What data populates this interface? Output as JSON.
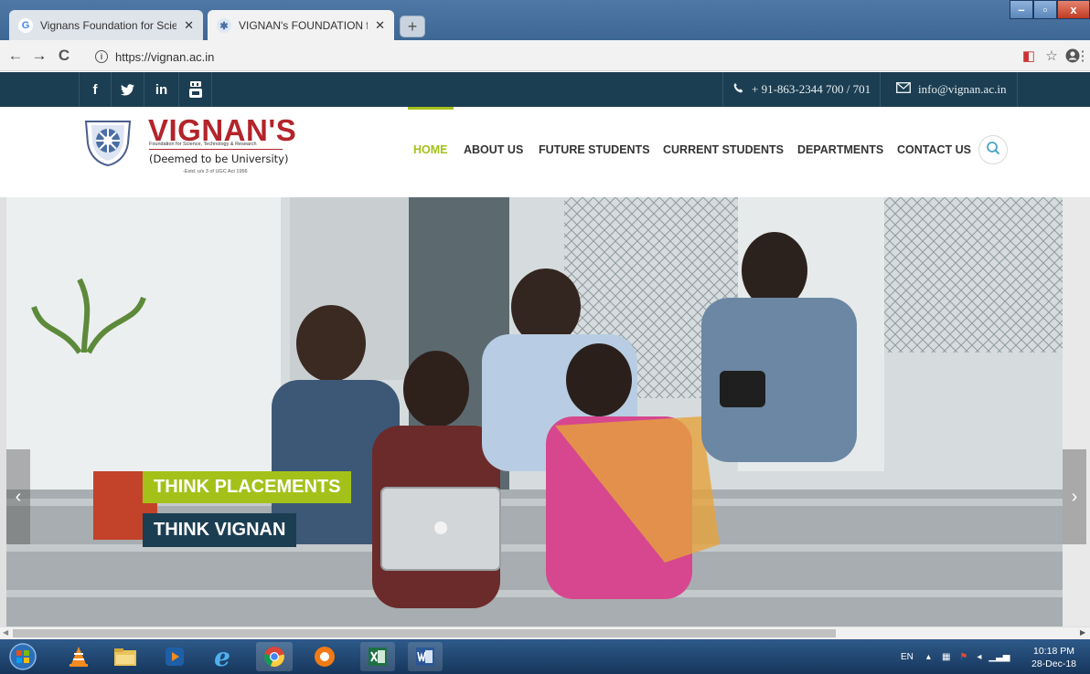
{
  "browser": {
    "tabs": [
      {
        "title": "Vignans Foundation for Science T",
        "favicon": "G",
        "active": false
      },
      {
        "title": "VIGNAN's FOUNDATION for SCIE",
        "favicon": "crest",
        "active": true
      }
    ],
    "url": "https://vignan.ac.in",
    "close_glyph": "✕",
    "new_tab_glyph": "+",
    "window_buttons": {
      "minimize": "–",
      "maximize": "▫",
      "close": "x"
    },
    "nav": {
      "back": "←",
      "forward": "→",
      "reload": "C"
    }
  },
  "site": {
    "social": [
      "f",
      "𝕪",
      "in",
      "▶"
    ],
    "contact": {
      "phone": "+ 91-863-2344 700 / 701",
      "email": "info@vignan.ac.in"
    },
    "logo": {
      "name": "VIGNAN'S",
      "subtitle": "Foundation for Science, Technology & Research",
      "deemed": "(Deemed to be University)",
      "estd": "-Estd. u/s 3 of UGC Act 1956"
    },
    "menu": [
      "HOME",
      "ABOUT US",
      "FUTURE STUDENTS",
      "CURRENT STUDENTS",
      "DEPARTMENTS",
      "CONTACT US"
    ],
    "active_menu": "HOME",
    "hero": {
      "caption1": "THINK PLACEMENTS",
      "caption2": "THINK VIGNAN",
      "prev": "‹",
      "next": "›"
    }
  },
  "taskbar": {
    "lang": "EN",
    "time": "10:18 PM",
    "date": "28-Dec-18",
    "apps": [
      "start-orb",
      "vlc",
      "file-explorer",
      "media-player",
      "internet-explorer",
      "chrome",
      "avast",
      "excel",
      "word"
    ]
  },
  "colors": {
    "navy": "#1c3e52",
    "green": "#a4c11a",
    "brand_red": "#b3242a"
  }
}
